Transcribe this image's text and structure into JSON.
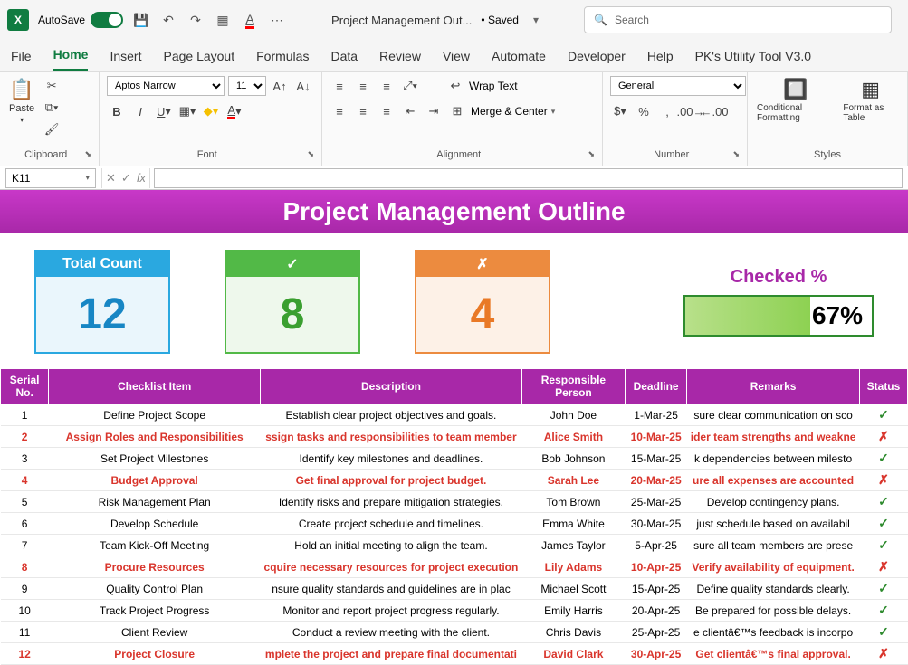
{
  "titlebar": {
    "autosave_label": "AutoSave",
    "autosave_on": "On",
    "doc_title": "Project Management Out...",
    "saved": "• Saved",
    "caret": "▾",
    "search_placeholder": "Search"
  },
  "tabs": [
    "File",
    "Home",
    "Insert",
    "Page Layout",
    "Formulas",
    "Data",
    "Review",
    "View",
    "Automate",
    "Developer",
    "Help",
    "PK's Utility Tool V3.0"
  ],
  "active_tab": "Home",
  "ribbon": {
    "clipboard": {
      "paste": "Paste",
      "label": "Clipboard"
    },
    "font": {
      "name": "Aptos Narrow",
      "size": "11",
      "label": "Font"
    },
    "alignment": {
      "wrap": "Wrap Text",
      "merge": "Merge & Center",
      "label": "Alignment"
    },
    "number": {
      "format": "General",
      "label": "Number"
    },
    "styles": {
      "cond": "Conditional Formatting",
      "fmt": "Format as Table",
      "label": "Styles"
    }
  },
  "formula": {
    "cell": "K11"
  },
  "sheet": {
    "title": "Project Management Outline",
    "cards": {
      "total_label": "Total Count",
      "total_value": "12",
      "check_label": "✓",
      "check_value": "8",
      "cross_label": "✗",
      "cross_value": "4"
    },
    "checked_label": "Checked %",
    "checked_value": "67%",
    "checked_width": "67%"
  },
  "headers": [
    "Serial No.",
    "Checklist Item",
    "Description",
    "Responsible Person",
    "Deadline",
    "Remarks",
    "Status"
  ],
  "rows": [
    {
      "n": "1",
      "item": "Define Project Scope",
      "desc": "Establish clear project objectives and goals.",
      "person": "John Doe",
      "deadline": "1-Mar-25",
      "remarks": "sure clear communication on sco",
      "ok": true
    },
    {
      "n": "2",
      "item": "Assign Roles and Responsibilities",
      "desc": "ssign tasks and responsibilities to team member",
      "person": "Alice Smith",
      "deadline": "10-Mar-25",
      "remarks": "ider team strengths and weakne",
      "ok": false
    },
    {
      "n": "3",
      "item": "Set Project Milestones",
      "desc": "Identify key milestones and deadlines.",
      "person": "Bob Johnson",
      "deadline": "15-Mar-25",
      "remarks": "k dependencies between milesto",
      "ok": true
    },
    {
      "n": "4",
      "item": "Budget Approval",
      "desc": "Get final approval for project budget.",
      "person": "Sarah Lee",
      "deadline": "20-Mar-25",
      "remarks": "ure all expenses are accounted",
      "ok": false
    },
    {
      "n": "5",
      "item": "Risk Management Plan",
      "desc": "Identify risks and prepare mitigation strategies.",
      "person": "Tom Brown",
      "deadline": "25-Mar-25",
      "remarks": "Develop contingency plans.",
      "ok": true
    },
    {
      "n": "6",
      "item": "Develop Schedule",
      "desc": "Create project schedule and timelines.",
      "person": "Emma White",
      "deadline": "30-Mar-25",
      "remarks": "just schedule based on availabil",
      "ok": true
    },
    {
      "n": "7",
      "item": "Team Kick-Off Meeting",
      "desc": "Hold an initial meeting to align the team.",
      "person": "James Taylor",
      "deadline": "5-Apr-25",
      "remarks": "sure all team members are prese",
      "ok": true
    },
    {
      "n": "8",
      "item": "Procure Resources",
      "desc": "cquire necessary resources for project execution",
      "person": "Lily Adams",
      "deadline": "10-Apr-25",
      "remarks": "Verify availability of equipment.",
      "ok": false
    },
    {
      "n": "9",
      "item": "Quality Control Plan",
      "desc": "nsure quality standards and guidelines are in plac",
      "person": "Michael Scott",
      "deadline": "15-Apr-25",
      "remarks": "Define quality standards clearly.",
      "ok": true
    },
    {
      "n": "10",
      "item": "Track Project Progress",
      "desc": "Monitor and report project progress regularly.",
      "person": "Emily Harris",
      "deadline": "20-Apr-25",
      "remarks": "Be prepared for possible delays.",
      "ok": true
    },
    {
      "n": "11",
      "item": "Client Review",
      "desc": "Conduct a review meeting with the client.",
      "person": "Chris Davis",
      "deadline": "25-Apr-25",
      "remarks": "e clientâ€™s feedback is incorpo",
      "ok": true
    },
    {
      "n": "12",
      "item": "Project Closure",
      "desc": "mplete the project and prepare final documentati",
      "person": "David Clark",
      "deadline": "30-Apr-25",
      "remarks": "Get clientâ€™s final approval.",
      "ok": false
    }
  ]
}
